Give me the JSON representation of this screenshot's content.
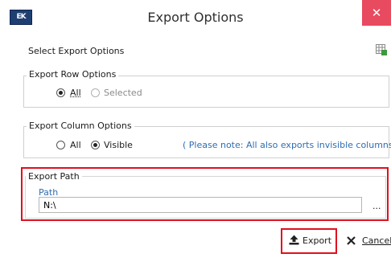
{
  "window": {
    "title": "Export Options",
    "close_label": "✕",
    "app_icon_text": "EK"
  },
  "header": {
    "select_label": "Select Export Options",
    "grid_icon": "grid-settings-icon"
  },
  "row_options": {
    "title": "Export Row Options",
    "all_label": "All",
    "selected_label": "Selected",
    "selected_value": "All"
  },
  "column_options": {
    "title": "Export Column Options",
    "all_label": "All",
    "visible_label": "Visible",
    "selected_value": "Visible",
    "note": "( Please note: All also exports invisible columns. )"
  },
  "export_path": {
    "title": "Export Path",
    "path_label": "Path",
    "path_value": "N:\\",
    "browse_label": "..."
  },
  "buttons": {
    "export_label": "Export",
    "cancel_label": "Cancel"
  },
  "colors": {
    "highlight": "#e0101e",
    "note": "#2e6db4",
    "close": "#e84a5f"
  }
}
